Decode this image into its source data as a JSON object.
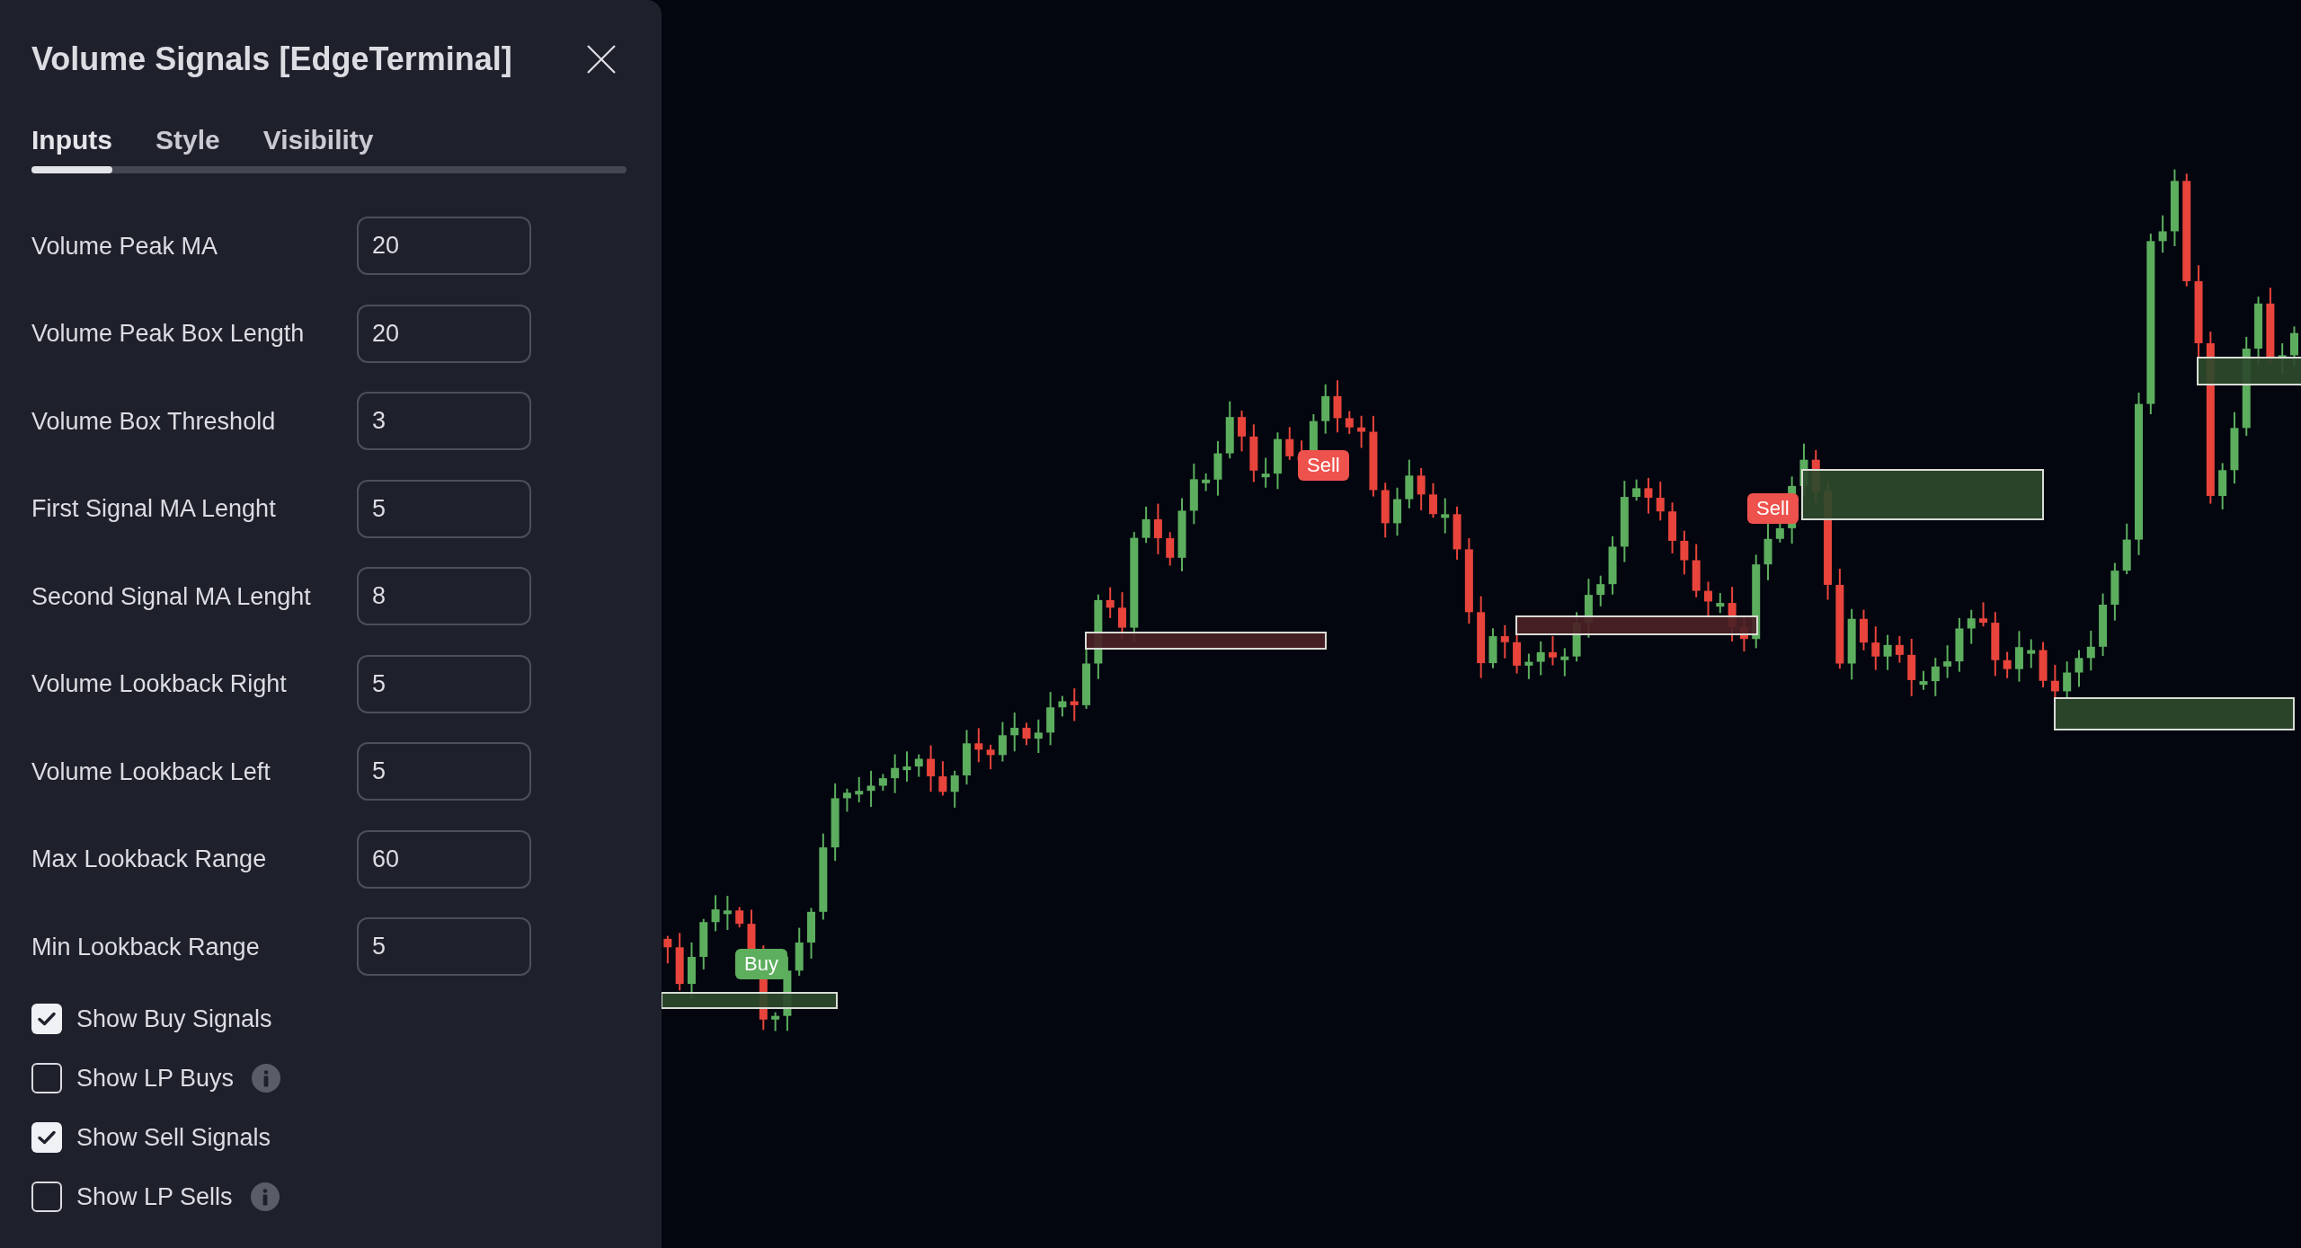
{
  "dialog": {
    "title": "Volume Signals [EdgeTerminal]"
  },
  "tabs": [
    {
      "label": "Inputs",
      "selected": true
    },
    {
      "label": "Style",
      "selected": false
    },
    {
      "label": "Visibility",
      "selected": false
    }
  ],
  "inputs": [
    {
      "label": "Volume Peak MA",
      "value": "20"
    },
    {
      "label": "Volume Peak Box Length",
      "value": "20"
    },
    {
      "label": "Volume Box Threshold",
      "value": "3"
    },
    {
      "label": "First Signal MA Lenght",
      "value": "5"
    },
    {
      "label": "Second Signal MA Lenght",
      "value": "8"
    },
    {
      "label": "Volume Lookback Right",
      "value": "5"
    },
    {
      "label": "Volume Lookback Left",
      "value": "5"
    },
    {
      "label": "Max Lookback Range",
      "value": "60"
    },
    {
      "label": "Min Lookback Range",
      "value": "5"
    }
  ],
  "checkboxes": [
    {
      "label": "Show Buy Signals",
      "checked": true,
      "info": false
    },
    {
      "label": "Show LP Buys",
      "checked": false,
      "info": true
    },
    {
      "label": "Show Sell Signals",
      "checked": true,
      "info": false
    },
    {
      "label": "Show LP Sells",
      "checked": false,
      "info": true
    }
  ],
  "chart": {
    "signals": [
      {
        "kind": "buy",
        "label": "Buy"
      },
      {
        "kind": "sell",
        "label": "Sell"
      },
      {
        "kind": "sell",
        "label": "Sell"
      }
    ]
  }
}
